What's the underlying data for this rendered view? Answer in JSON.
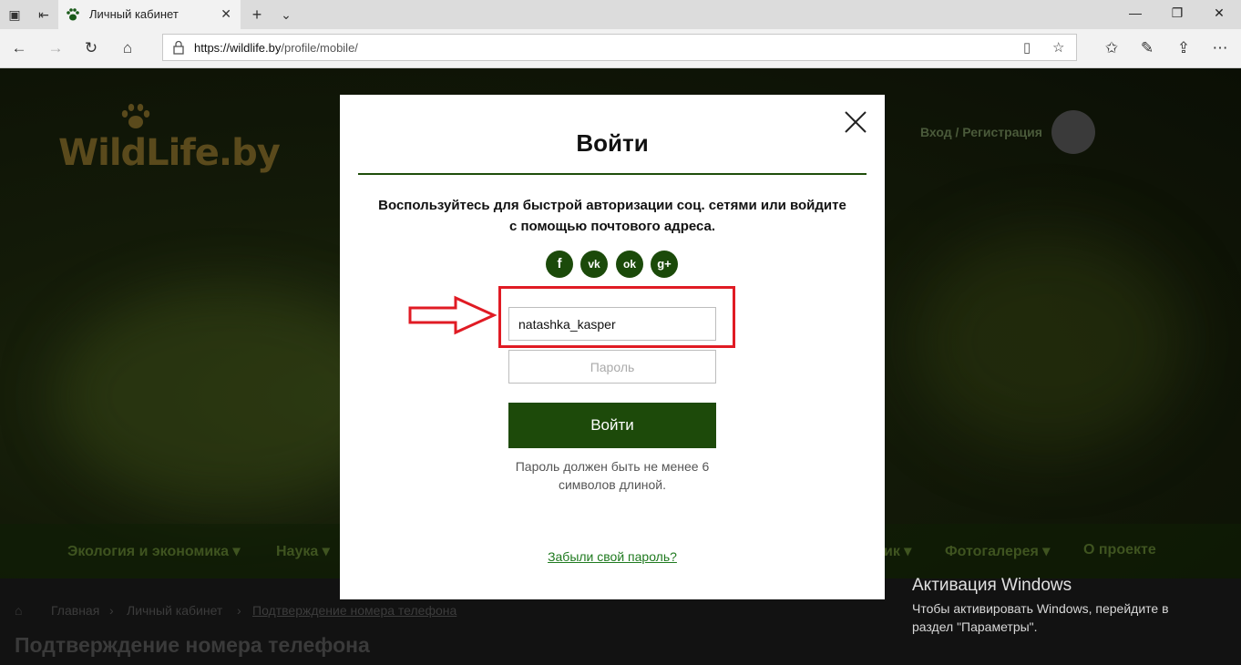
{
  "browser": {
    "tab_title": "Личный кабинет",
    "url_host": "https://wildlife.by",
    "url_path": "/profile/mobile/"
  },
  "site": {
    "logo_text": "WildLife.by",
    "login_link": "Вход / Регистрация",
    "menu": [
      "Экология и экономика ▾",
      "Наука ▾",
      "ик ▾",
      "Фотогалерея ▾",
      "О проекте"
    ],
    "breadcrumbs": [
      "Главная",
      "Личный кабинет",
      "Подтверждение номера телефона"
    ],
    "page_title": "Подтверждение номера телефона"
  },
  "modal": {
    "title": "Войти",
    "lead": "Воспользуйтесь для быстрой авторизации соц. сетями или войдите с помощью почтового адреса.",
    "social": [
      "f",
      "vk",
      "ok",
      "g+"
    ],
    "username_value": "natashka_kasper",
    "password_placeholder": "Пароль",
    "submit_label": "Войти",
    "hint": "Пароль должен быть не менее 6 символов длиной.",
    "forgot": "Забыли свой пароль?"
  },
  "activation": {
    "title": "Активация Windows",
    "text": "Чтобы активировать Windows, перейдите в раздел \"Параметры\"."
  },
  "colors": {
    "accent": "#1d4a0a",
    "highlight": "#e01b24",
    "link": "#1f7a1f"
  }
}
